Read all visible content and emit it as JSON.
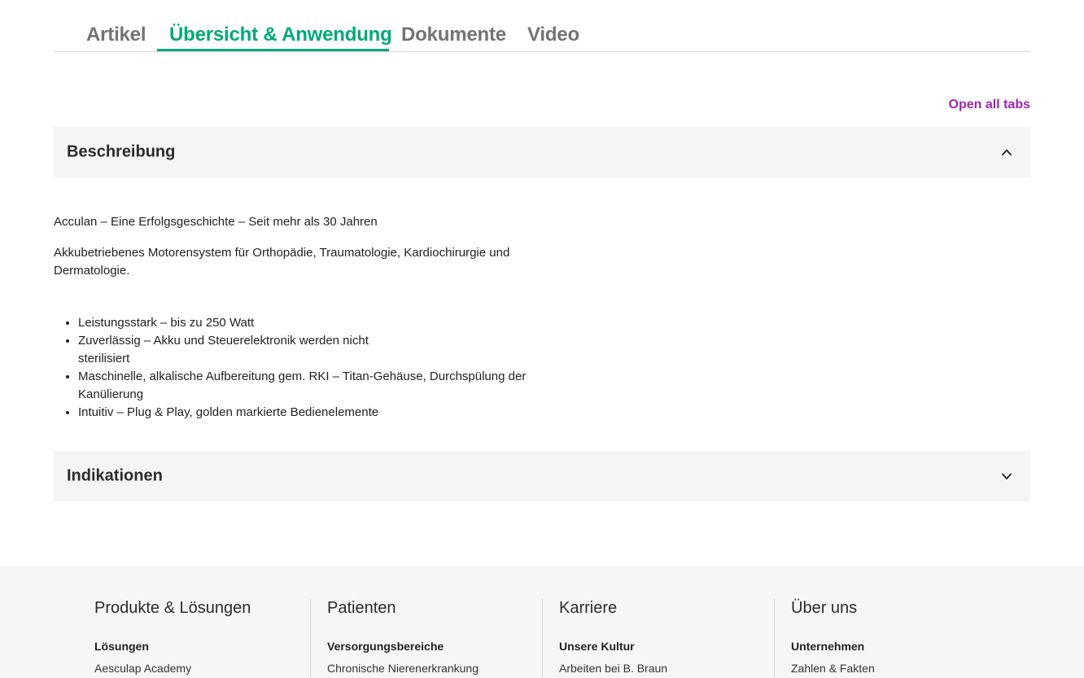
{
  "tabs": {
    "items": [
      {
        "label": "Artikel"
      },
      {
        "label": "Übersicht & Anwendung"
      },
      {
        "label": "Dokumente"
      },
      {
        "label": "Video"
      }
    ],
    "active_index": 1
  },
  "open_all_label": "Open all tabs",
  "accordion": {
    "sections": [
      {
        "title": "Beschreibung",
        "expanded": true,
        "icon": "chevron-up-icon"
      },
      {
        "title": "Indikationen",
        "expanded": false,
        "icon": "chevron-down-icon"
      }
    ]
  },
  "description": {
    "paragraphs": [
      "Acculan – Eine Erfolgsgeschichte – Seit mehr als 30 Jahren",
      "Akkubetriebenes Motorensystem für Orthopädie, Traumatologie, Kardiochirurgie und Dermatologie."
    ],
    "bullets": [
      "Leistungsstark – bis zu 250 Watt",
      "Zuverlässig – Akku und Steuerelektronik werden nicht sterilisiert",
      "Maschinelle, alkalische Aufbereitung gem. RKI – Titan-Gehäuse, Durchspülung der Kanülierung",
      "Intuitiv – Plug & Play, golden markierte Bedienelemente"
    ]
  },
  "footer": {
    "columns": [
      {
        "heading": "Produkte & Lösungen",
        "subheading": "Lösungen",
        "link": "Aesculap Academy"
      },
      {
        "heading": "Patienten",
        "subheading": "Versorgungsbereiche",
        "link": "Chronische Nierenerkrankung"
      },
      {
        "heading": "Karriere",
        "subheading": "Unsere Kultur",
        "link": "Arbeiten bei B. Braun"
      },
      {
        "heading": "Über uns",
        "subheading": "Unternehmen",
        "link": "Zahlen & Fakten"
      }
    ]
  },
  "colors": {
    "accent_green": "#00a97a",
    "link_purple": "#9c27b0",
    "accordion_bg": "#f5f5f5",
    "footer_bg": "#f6f6f4"
  }
}
